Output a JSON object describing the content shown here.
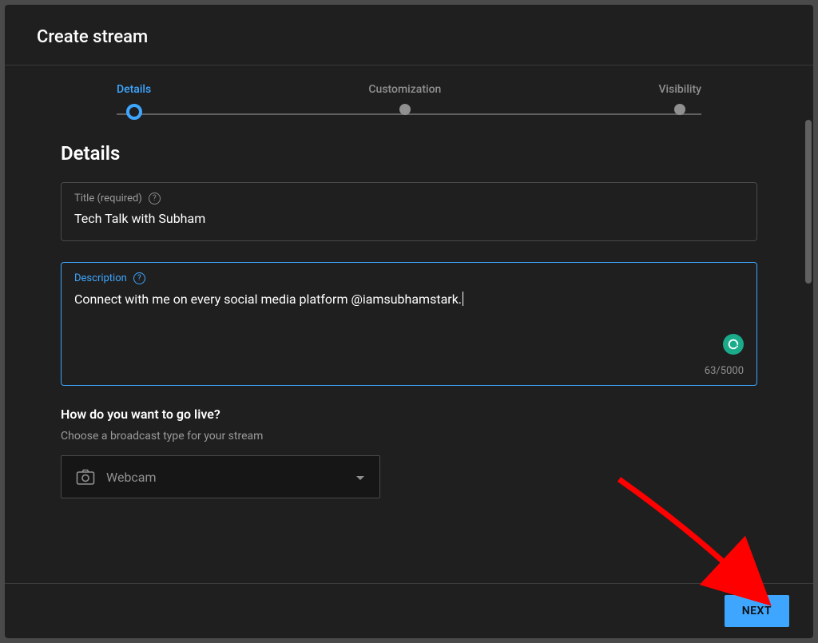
{
  "header": {
    "title": "Create stream"
  },
  "stepper": {
    "steps": [
      {
        "label": "Details",
        "active": true
      },
      {
        "label": "Customization",
        "active": false
      },
      {
        "label": "Visibility",
        "active": false
      }
    ]
  },
  "details": {
    "heading": "Details",
    "title_field": {
      "label": "Title (required)",
      "value": "Tech Talk with Subham"
    },
    "description_field": {
      "label": "Description",
      "value": "Connect with me on every social media platform @iamsubhamstark.",
      "char_count": "63/5000"
    },
    "broadcast": {
      "question": "How do you want to go live?",
      "subtext": "Choose a broadcast type for your stream",
      "selected": "Webcam"
    }
  },
  "footer": {
    "next": "NEXT"
  }
}
